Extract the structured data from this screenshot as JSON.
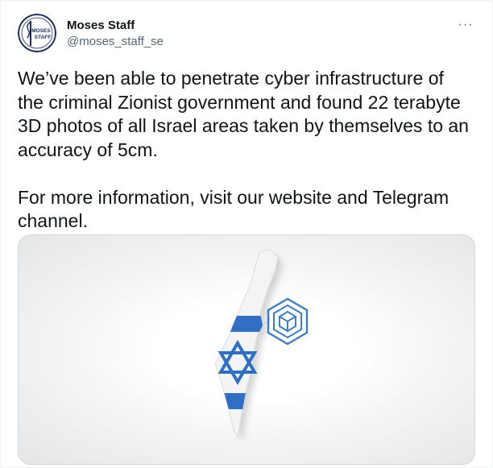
{
  "user": {
    "display_name": "Moses Staff",
    "handle": "@moses_staff_se",
    "avatar_text_line1": "MOSES",
    "avatar_text_line2": "STAFF"
  },
  "tweet": {
    "text": "We’ve been able to penetrate cyber infrastructure of\nthe criminal Zionist government and found 22 terabyte\n3D photos of all Israel areas taken by themselves to an\naccuracy of 5cm.\n\nFor more information, visit our website and Telegram\nchannel."
  },
  "more_button": {
    "label": "···"
  },
  "colors": {
    "text_primary": "#0f1419",
    "text_secondary": "#536471",
    "border": "#cfd9de",
    "flag_blue": "#2f6fc4",
    "logo_blue": "#3b7fc4"
  },
  "media": {
    "icons": [
      "israel-map-flag-icon",
      "star-of-david-icon",
      "hexagon-cube-logo-icon"
    ]
  }
}
